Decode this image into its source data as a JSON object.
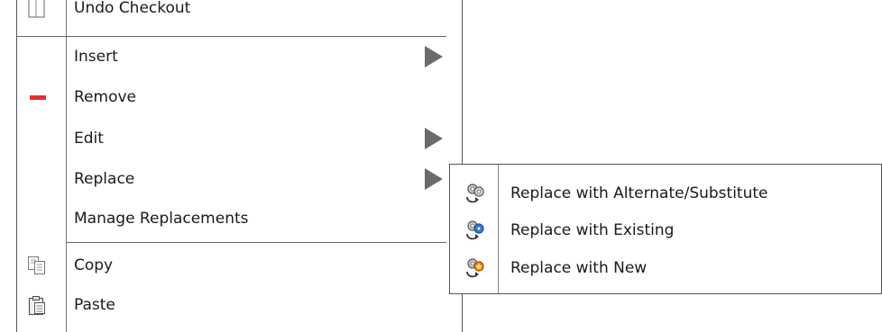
{
  "context_menu": {
    "items": [
      {
        "label": "Undo Checkout",
        "icon": "undo-checkout-icon"
      },
      {
        "label": "Insert",
        "has_submenu": true
      },
      {
        "label": "Remove",
        "icon": "remove-icon"
      },
      {
        "label": "Edit",
        "has_submenu": true
      },
      {
        "label": "Replace",
        "has_submenu": true
      },
      {
        "label": "Manage Replacements"
      },
      {
        "label": "Copy",
        "icon": "copy-icon"
      },
      {
        "label": "Paste",
        "icon": "paste-icon"
      }
    ]
  },
  "replace_submenu": {
    "items": [
      {
        "label": "Replace with Alternate/Substitute",
        "icon": "replace-alternate-icon"
      },
      {
        "label": "Replace with Existing",
        "icon": "replace-existing-icon"
      },
      {
        "label": "Replace with New",
        "icon": "replace-new-icon"
      }
    ]
  },
  "colors": {
    "remove_icon": "#e53030",
    "submenu_arrow": "#6b6b6b",
    "replace_existing_accent": "#3a7bd5",
    "replace_new_accent": "#f08020"
  }
}
